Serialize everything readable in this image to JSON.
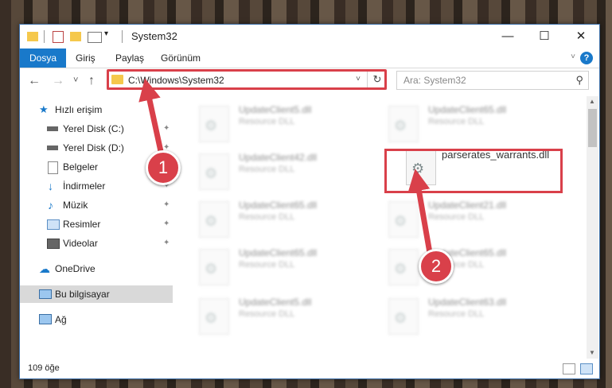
{
  "window": {
    "title": "System32",
    "minimize_glyph": "—",
    "maximize_glyph": "☐",
    "close_glyph": "✕"
  },
  "ribbon": {
    "tabs": [
      {
        "label": "Dosya",
        "active": true
      },
      {
        "label": "Giriş"
      },
      {
        "label": "Paylaş"
      },
      {
        "label": "Görünüm"
      }
    ],
    "help_glyph": "?",
    "collapse_glyph": "˅"
  },
  "navigation": {
    "back_glyph": "←",
    "forward_glyph": "→",
    "recent_glyph": "˅",
    "up_glyph": "↑",
    "address": "C:\\Windows\\System32",
    "address_dropdown_glyph": "˅",
    "refresh_glyph": "↻",
    "search_placeholder": "Ara: System32",
    "search_glyph": "⚲"
  },
  "nav_pane": {
    "quick_access": "Hızlı erişim",
    "items": [
      {
        "label": "Yerel Disk (C:)",
        "icon": "drive-icon"
      },
      {
        "label": "Yerel Disk (D:)",
        "icon": "drive-icon"
      },
      {
        "label": "Belgeler",
        "icon": "documents-icon"
      },
      {
        "label": "İndirmeler",
        "icon": "downloads-icon"
      },
      {
        "label": "Müzik",
        "icon": "music-icon"
      },
      {
        "label": "Resimler",
        "icon": "pictures-icon"
      },
      {
        "label": "Videolar",
        "icon": "videos-icon"
      }
    ],
    "onedrive": "OneDrive",
    "this_pc": "Bu bilgisayar",
    "network": "Ağ",
    "pin_glyph": "✦"
  },
  "files": [
    {
      "name": "UpdateClient5.dll",
      "type": "Resource DLL"
    },
    {
      "name": "UpdateClient65.dll",
      "type": "Resource DLL"
    },
    {
      "name": "UpdateClient42.dll",
      "type": "Resource DLL"
    },
    {
      "name": "parserates_warrants.dll",
      "type": ""
    },
    {
      "name": "UpdateClient65.dll",
      "type": "Resource DLL"
    },
    {
      "name": "UpdateClient21.dll",
      "type": "Resource DLL"
    },
    {
      "name": "UpdateClient65.dll",
      "type": "Resource DLL"
    },
    {
      "name": "UpdateClient65.dll",
      "type": "Resource DLL"
    },
    {
      "name": "UpdateClient5.dll",
      "type": "Resource DLL"
    },
    {
      "name": "UpdateClient63.dll",
      "type": "Resource DLL"
    }
  ],
  "status": {
    "count": "109 öğe"
  },
  "annotations": {
    "step1": "1",
    "step2": "2",
    "color": "#d9404a"
  },
  "colors": {
    "accent": "#1979ca",
    "folder": "#f5c84c",
    "highlight": "#d9404a"
  }
}
